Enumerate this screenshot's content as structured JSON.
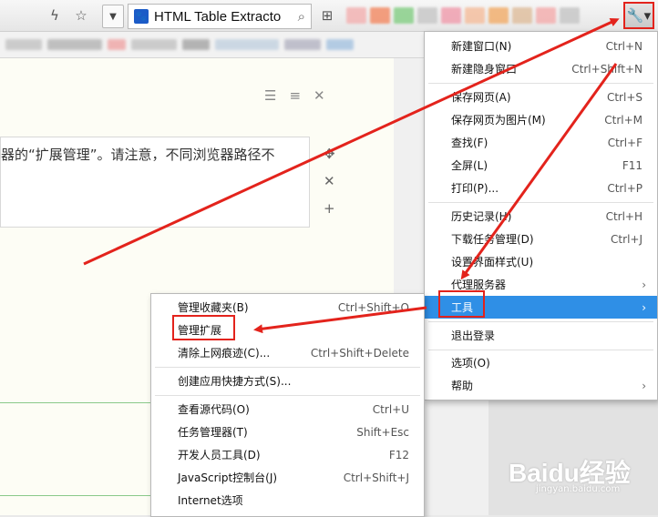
{
  "toolbar": {
    "search_engine_icon": "paw-icon",
    "search_text": "HTML Table Extracto",
    "icons": [
      "lightning-icon",
      "star-icon",
      "dropdown-icon",
      "search-icon",
      "grid-icon",
      "wrench-icon"
    ]
  },
  "editor": {
    "body_text": "器的“扩展管理”。请注意，不同浏览器路径不"
  },
  "main_menu": {
    "items": [
      {
        "label": "新建窗口(N)",
        "shortcut": "Ctrl+N"
      },
      {
        "label": "新建隐身窗口",
        "shortcut": "Ctrl+Shift+N"
      },
      {
        "label": "保存网页(A)",
        "shortcut": "Ctrl+S"
      },
      {
        "label": "保存网页为图片(M)",
        "shortcut": "Ctrl+M"
      },
      {
        "label": "查找(F)",
        "shortcut": "Ctrl+F"
      },
      {
        "label": "全屏(L)",
        "shortcut": "F11"
      },
      {
        "label": "打印(P)...",
        "shortcut": "Ctrl+P"
      },
      {
        "label": "历史记录(H)",
        "shortcut": "Ctrl+H"
      },
      {
        "label": "下载任务管理(D)",
        "shortcut": "Ctrl+J"
      },
      {
        "label": "设置界面样式(U)",
        "shortcut": ""
      },
      {
        "label": "代理服务器",
        "shortcut": ""
      },
      {
        "label": "工具",
        "shortcut": ""
      },
      {
        "label": "退出登录",
        "shortcut": ""
      },
      {
        "label": "选项(O)",
        "shortcut": ""
      },
      {
        "label": "帮助",
        "shortcut": ""
      }
    ]
  },
  "tools_submenu": {
    "items": [
      {
        "label": "管理收藏夹(B)",
        "shortcut": "Ctrl+Shift+O"
      },
      {
        "label": "管理扩展",
        "shortcut": ""
      },
      {
        "label": "清除上网痕迹(C)...",
        "shortcut": "Ctrl+Shift+Delete"
      },
      {
        "label": "创建应用快捷方式(S)...",
        "shortcut": ""
      },
      {
        "label": "查看源代码(O)",
        "shortcut": "Ctrl+U"
      },
      {
        "label": "任务管理器(T)",
        "shortcut": "Shift+Esc"
      },
      {
        "label": "开发人员工具(D)",
        "shortcut": "F12"
      },
      {
        "label": "JavaScript控制台(J)",
        "shortcut": "Ctrl+Shift+J"
      },
      {
        "label": "Internet选项",
        "shortcut": ""
      }
    ]
  },
  "watermark": {
    "main": "Baidu经验",
    "sub": "jingyan.baidu.com"
  },
  "colors": {
    "highlight": "#2f8fe6",
    "annotation": "#e3231c"
  }
}
